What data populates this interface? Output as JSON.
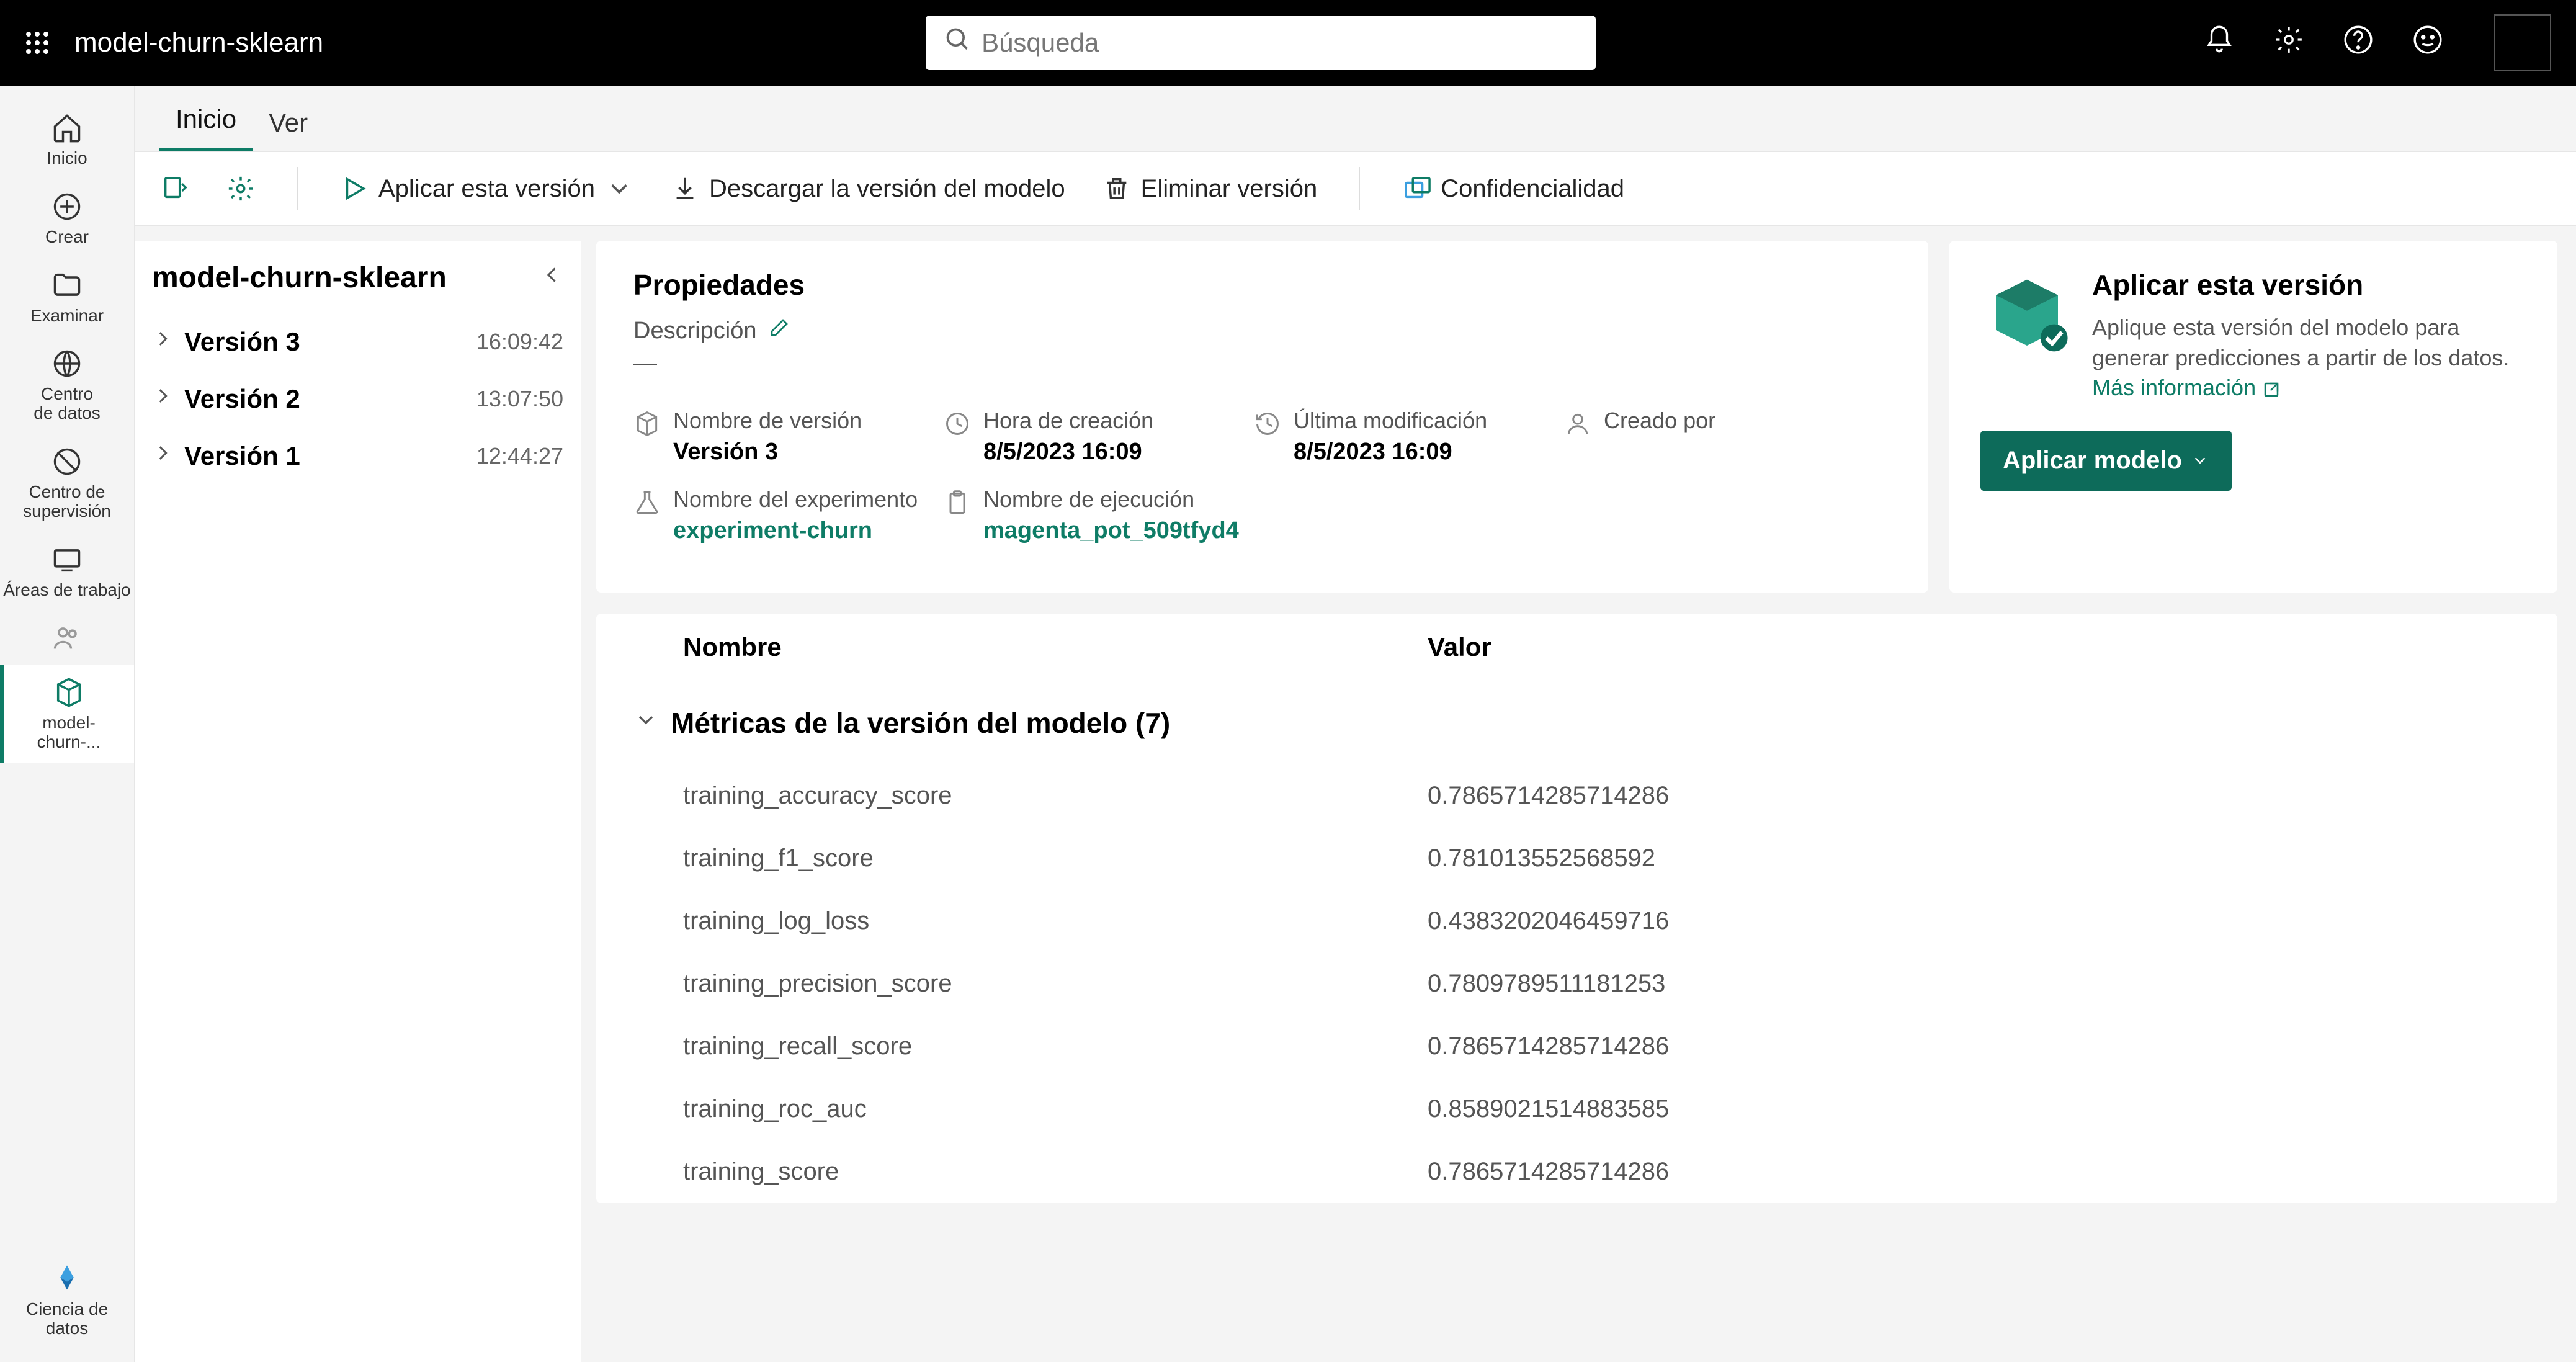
{
  "header": {
    "title": "model-churn-sklearn",
    "search_placeholder": "Búsqueda"
  },
  "leftnav": {
    "home": "Inicio",
    "create": "Crear",
    "browse": "Examinar",
    "datacenter_line1": "Centro",
    "datacenter_line2": "de datos",
    "monitor_line1": "Centro de",
    "monitor_line2": "supervisión",
    "workspaces": "Áreas de trabajo",
    "active_item_line1": "model-",
    "active_item_line2": "churn-...",
    "ds_line1": "Ciencia de",
    "ds_line2": "datos"
  },
  "tabs": {
    "home": "Inicio",
    "view": "Ver"
  },
  "toolbar": {
    "apply": "Aplicar esta versión",
    "download": "Descargar la versión del modelo",
    "delete": "Eliminar versión",
    "confidentiality": "Confidencialidad"
  },
  "versions": {
    "title": "model-churn-sklearn",
    "items": [
      {
        "name": "Versión 3",
        "time": "16:09:42"
      },
      {
        "name": "Versión 2",
        "time": "13:07:50"
      },
      {
        "name": "Versión 1",
        "time": "12:44:27"
      }
    ]
  },
  "properties": {
    "title": "Propiedades",
    "desc_label": "Descripción",
    "desc_value": "—",
    "version_name_label": "Nombre de versión",
    "version_name_value": "Versión 3",
    "created_label": "Hora de creación",
    "created_value": "8/5/2023 16:09",
    "modified_label": "Última modificación",
    "modified_value": "8/5/2023 16:09",
    "createdby_label": "Creado por",
    "experiment_label": "Nombre del experimento",
    "experiment_value": "experiment-churn",
    "run_label": "Nombre de ejecución",
    "run_value": "magenta_pot_509tfyd4"
  },
  "apply": {
    "title": "Aplicar esta versión",
    "text": "Aplique esta versión del modelo para generar predicciones a partir de los datos. ",
    "link": "Más información",
    "button": "Aplicar modelo"
  },
  "metrics": {
    "col_name": "Nombre",
    "col_value": "Valor",
    "group_title": "Métricas de la versión del modelo (7)",
    "rows": [
      {
        "name": "training_accuracy_score",
        "value": "0.7865714285714286"
      },
      {
        "name": "training_f1_score",
        "value": "0.781013552568592"
      },
      {
        "name": "training_log_loss",
        "value": "0.4383202046459716"
      },
      {
        "name": "training_precision_score",
        "value": "0.7809789511181253"
      },
      {
        "name": "training_recall_score",
        "value": "0.7865714285714286"
      },
      {
        "name": "training_roc_auc",
        "value": "0.8589021514883585"
      },
      {
        "name": "training_score",
        "value": "0.7865714285714286"
      }
    ]
  }
}
